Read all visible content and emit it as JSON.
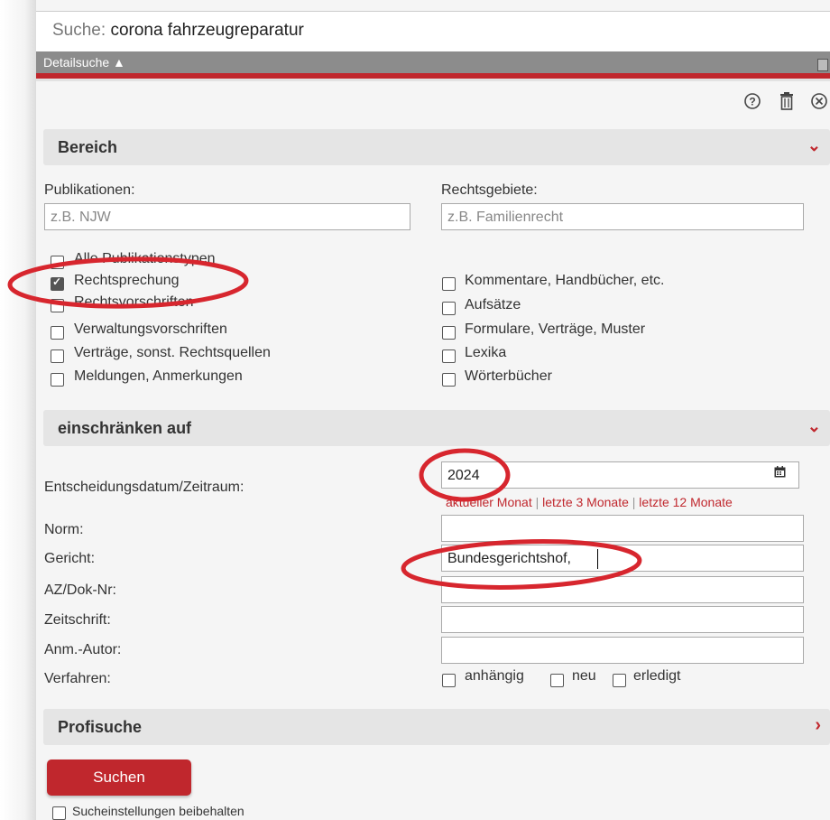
{
  "search": {
    "label": "Suche:",
    "query": "corona fahrzeugreparatur"
  },
  "detail": {
    "label": "Detailsuche ▲"
  },
  "toolbar": {
    "help_icon": "?",
    "trash_icon": "🗑",
    "close_icon": "⊗"
  },
  "bereich": {
    "title": "Bereich",
    "publikationen_label": "Publikationen:",
    "publikationen_placeholder": "z.B. NJW",
    "rechtsgebiete_label": "Rechtsgebiete:",
    "rechtsgebiete_placeholder": "z.B. Familienrecht",
    "types_left": [
      {
        "label": "Alle Publikationstypen",
        "checked": false
      },
      {
        "label": "Rechtsprechung",
        "checked": true
      },
      {
        "label": "Rechtsvorschriften",
        "checked": false
      },
      {
        "label": "Verwaltungsvorschriften",
        "checked": false
      },
      {
        "label": "Verträge, sonst. Rechtsquellen",
        "checked": false
      },
      {
        "label": "Meldungen, Anmerkungen",
        "checked": false
      }
    ],
    "types_right": [
      {
        "label": "Kommentare, Handbücher, etc.",
        "checked": false
      },
      {
        "label": "Aufsätze",
        "checked": false
      },
      {
        "label": "Formulare, Verträge, Muster",
        "checked": false
      },
      {
        "label": "Lexika",
        "checked": false
      },
      {
        "label": "Wörterbücher",
        "checked": false
      }
    ]
  },
  "einschraenken": {
    "title": "einschränken auf",
    "datum_label": "Entscheidungsdatum/Zeitraum:",
    "datum_value": "2024",
    "quick": [
      "aktueller Monat",
      "letzte 3 Monate",
      "letzte 12 Monate"
    ],
    "norm_label": "Norm:",
    "norm_value": "",
    "gericht_label": "Gericht:",
    "gericht_value": "Bundesgerichtshof,",
    "az_label": "AZ/Dok-Nr:",
    "az_value": "",
    "zeitschrift_label": "Zeitschrift:",
    "zeitschrift_value": "",
    "autor_label": "Anm.-Autor:",
    "autor_value": "",
    "verfahren_label": "Verfahren:",
    "verfahren_options": [
      {
        "label": "anhängig",
        "checked": false
      },
      {
        "label": "neu",
        "checked": false
      },
      {
        "label": "erledigt",
        "checked": false
      }
    ]
  },
  "profisuche": {
    "title": "Profisuche"
  },
  "actions": {
    "search_button": "Suchen",
    "keep_settings": "Sucheinstellungen beibehalten",
    "keep_checked": false
  },
  "annotation_color": "#d7262e",
  "accent_color": "#c0272d"
}
